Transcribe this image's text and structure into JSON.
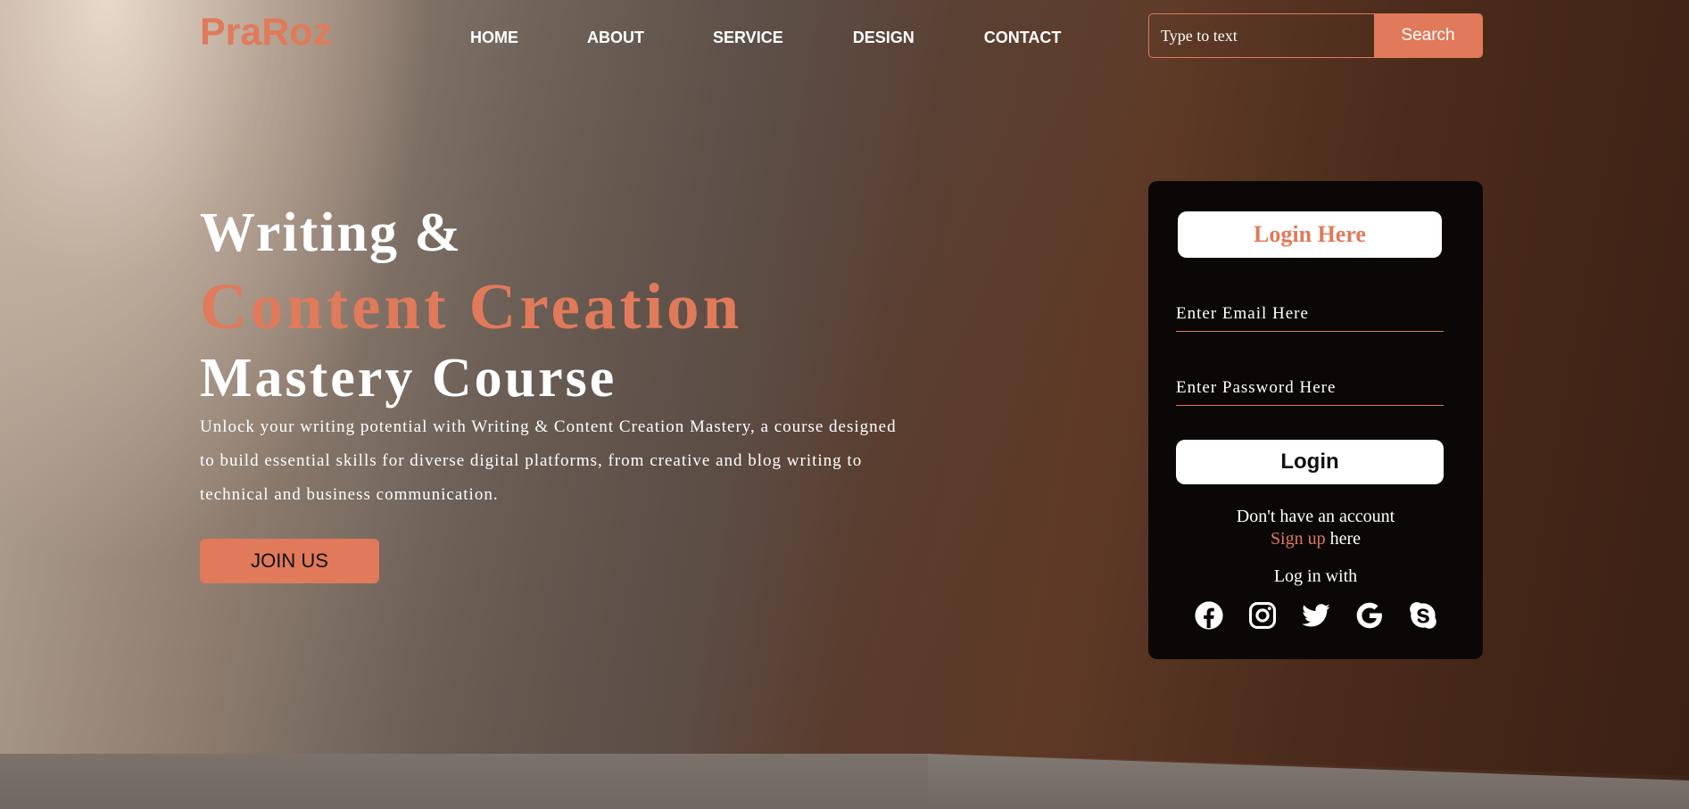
{
  "brand": {
    "logo": "PraRoz",
    "accent_color": "#e07a5a"
  },
  "nav": {
    "items": [
      "HOME",
      "ABOUT",
      "SERVICE",
      "DESIGN",
      "CONTACT"
    ]
  },
  "search": {
    "placeholder": "Type to text",
    "button_label": "Search"
  },
  "hero": {
    "line1": "Writing &",
    "line2": "Content Creation",
    "line3": "Mastery Course",
    "description": "Unlock your writing potential with Writing & Content Creation Mastery, a course designed to build essential skills for diverse digital platforms, from creative and blog writing to technical and business communication.",
    "cta_label": "JOIN US"
  },
  "login": {
    "title": "Login Here",
    "email_placeholder": "Enter Email Here",
    "password_placeholder": "Enter Password Here",
    "button_label": "Login",
    "no_account_text": "Don't have an account",
    "signup_link": "Sign up",
    "signup_suffix": " here",
    "login_with_text": "Log in with",
    "social_icons": [
      "facebook-icon",
      "instagram-icon",
      "twitter-icon",
      "google-icon",
      "skype-icon"
    ]
  }
}
